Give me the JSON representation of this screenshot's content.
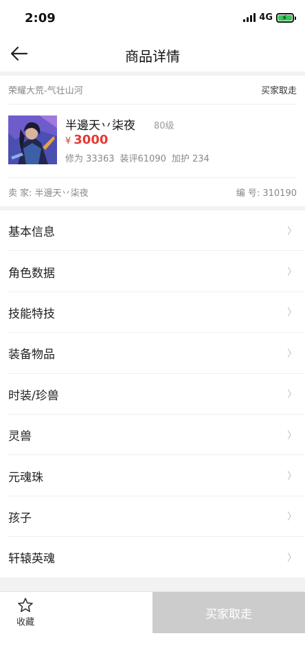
{
  "status_bar": {
    "time": "2:09",
    "network": "4G",
    "icons": [
      "signal-icon",
      "battery-charging-icon"
    ],
    "battery_color": "#35c759"
  },
  "nav": {
    "title": "商品详情",
    "back_icon": "arrow-left-icon"
  },
  "product": {
    "server": "荣耀大荒-气壮山河",
    "trade_mode": "买家取走",
    "name": "半邊天丷柒夜",
    "level": "80级",
    "price_symbol": "¥",
    "price": "3000",
    "stats": {
      "cultivation": "修为 33363",
      "equip_score": "装评61090",
      "protection": "加护 234"
    },
    "seller": "卖  家: 半邊天丷柒夜",
    "serial": "编  号: 310190"
  },
  "menu": {
    "items": [
      {
        "label": "基本信息"
      },
      {
        "label": "角色数据"
      },
      {
        "label": "技能特技"
      },
      {
        "label": "装备物品"
      },
      {
        "label": "时装/珍兽"
      },
      {
        "label": "灵兽"
      },
      {
        "label": "元魂珠"
      },
      {
        "label": "孩子"
      },
      {
        "label": "轩辕英魂"
      }
    ],
    "chevron": "〉"
  },
  "bottom": {
    "favorite_label": "收藏",
    "favorite_icon": "star-outline-icon",
    "buy_label": "买家取走",
    "buy_color": "#cccccc"
  },
  "colors": {
    "price": "#e53935",
    "muted_text": "#888888",
    "separator": "#f2f2f2"
  }
}
